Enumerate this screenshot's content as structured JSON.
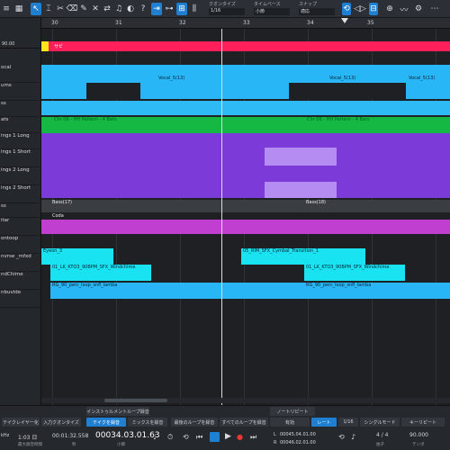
{
  "toolbar": {
    "quantize_label": "クオンタイズ",
    "quantize_value": "1/16",
    "timebase_label": "タイムベース",
    "timebase_value": "小節",
    "snap_label": "スナップ",
    "snap_value": "適応",
    "help": "?"
  },
  "ruler": {
    "bars": [
      "30",
      "31",
      "32",
      "33",
      "34",
      "35"
    ]
  },
  "tracks": [
    {
      "name": "ocal"
    },
    {
      "name": "ums"
    },
    {
      "name": "ss"
    },
    {
      "name": "ats"
    },
    {
      "name": "ings 1 Long"
    },
    {
      "name": "ings 1 Short"
    },
    {
      "name": "ings 2 Long"
    },
    {
      "name": "ings 2 Short"
    },
    {
      "name": "ss"
    },
    {
      "name": "itar"
    },
    {
      "name": "ontoop"
    },
    {
      "name": "nvrse _mfxd"
    },
    {
      "name": "ndChime"
    },
    {
      "name": "nbuvlde"
    }
  ],
  "marker": {
    "label": "サビ",
    "value": "90.00"
  },
  "clips": {
    "vocal_a": "Vocal_5(13)",
    "vocal_b": "Vocal_5(13)",
    "vocal_c": "Vocal_5(13)",
    "hats_a": "Chr 06 - HH Pattern - 4 Bars",
    "hats_b": "Chr 06 - HH Pattern - 4 Bars",
    "bass_a": "Bass(17)",
    "bass_b": "Bass(18)",
    "guitar": "Coda",
    "sfx_a": "Eyeon_3",
    "sfx_b": "05_RIM_SFX_Cymbal_Transition_1",
    "wind_a": "01_LK_KTO3_90BPM_SFX_Windchime",
    "wind_b": "01_LK_KTO3_90BPM_SFX_Windchime",
    "perc_a": "RG_90_perc_loop_snfl_lamba",
    "perc_b": "RG_90_perc_loop_snfl_lamba"
  },
  "bottom": {
    "instrument_tab": "インストゥルメントループ録音",
    "note_repeat": "ノートリピート",
    "tab1": "テイクを録音",
    "tab2": "ミックスを録音",
    "tab3": "最後のループを録音",
    "tab4": "すべてのループを録音",
    "left1": "テイクレイヤー化",
    "left2": "入力クオンタイズ",
    "r_on": "有効",
    "r_rate": "レート",
    "r_val": "1/16",
    "r_mode": "シングルモード",
    "r_latch": "キーリピート",
    "sample_rate": "kHz",
    "rec_time": "1:03 日",
    "rec_label": "最大録音時間",
    "sec": "00:01:32.558",
    "sec_label": "秒",
    "position": "00034.03.01.63",
    "position_label": "小節",
    "loop_l": "00045.04.01.00",
    "loop_r": "00046.02.01.00",
    "meter": "4 / 4",
    "tempo": "90.000",
    "meter_label": "拍子",
    "tempo_label": "テンポ",
    "l": "L",
    "r": "R"
  }
}
